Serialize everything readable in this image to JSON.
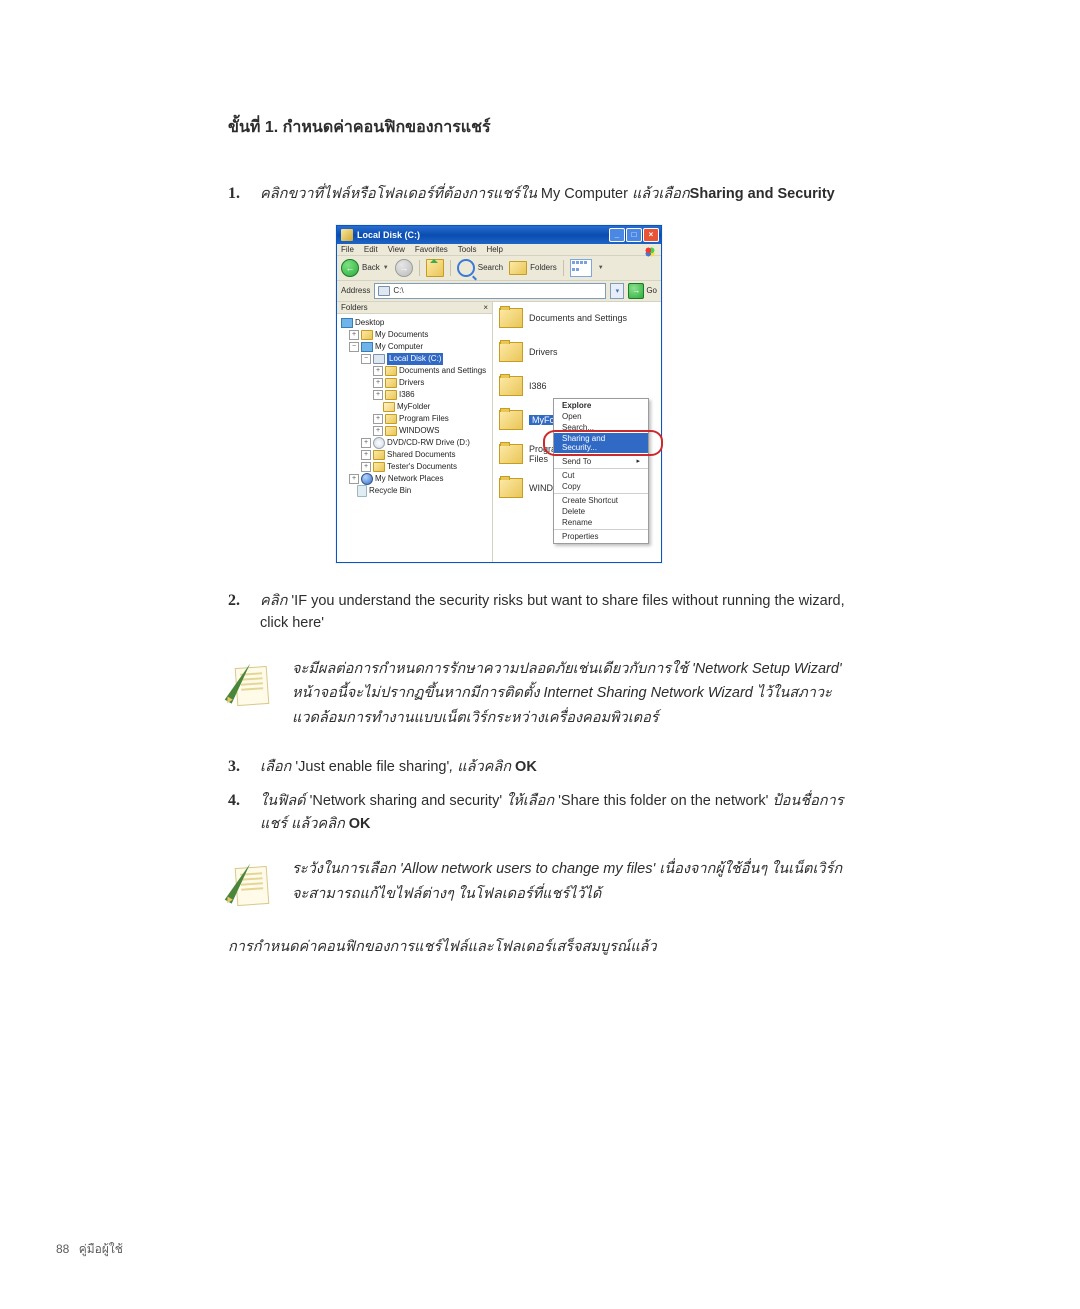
{
  "section_title": "ขั้นที่ 1. กำหนดค่าคอนฟิกของการแชร์",
  "steps": {
    "s1": {
      "num": "1.",
      "pre": "คลิกขวาที่ไฟล์หรือโฟลเดอร์ที่ต้องการแชร์ใน ",
      "em": "My Computer",
      "mid": " แล้วเลือก",
      "bold": "Sharing and Security"
    },
    "s2": {
      "num": "2.",
      "pre": "คลิก ",
      "quote": "'IF you understand the security risks but want to share files without running the wizard, click here'"
    },
    "s3": {
      "num": "3.",
      "pre": "เลือก ",
      "quote": "'Just enable file sharing'",
      "mid": ", แล้วคลิก ",
      "bold": "OK"
    },
    "s4": {
      "num": "4.",
      "pre": "ในฟิลด์ ",
      "q1": "'Network sharing and security'",
      "mid": " ให้เลือก ",
      "q2": "'Share this folder on the network'",
      "post": " ป้อนชื่อการแชร์ แล้วคลิก ",
      "bold": "OK"
    }
  },
  "info1": {
    "l1": "จะมีผลต่อการกำหนดการรักษาความปลอดภัยเช่นเดียวกับการใช้ 'Network Setup Wizard'",
    "l2": "หน้าจอนี้จะไม่ปรากฏขึ้นหากมีการติดตั้ง Internet Sharing Network Wizard ไว้ในสภาวะแวดล้อมการทำงานแบบเน็ตเวิร์กระหว่างเครื่องคอมพิวเตอร์"
  },
  "info2": {
    "text": "ระวังในการเลือก 'Allow network users to change my files' เนื่องจากผู้ใช้อื่นๆ ในเน็ตเวิร์กจะสามารถแก้ไขไฟล์ต่างๆ ในโฟลเดอร์ที่แชร์ไว้ได้"
  },
  "closing": "การกำหนดค่าคอนฟิกของการแชร์ไฟล์และโฟลเดอร์เสร็จสมบูรณ์แล้ว",
  "footer": {
    "page": "88",
    "label": "คู่มือผู้ใช้"
  },
  "win": {
    "title": "Local Disk (C:)",
    "menus": [
      "File",
      "Edit",
      "View",
      "Favorites",
      "Tools",
      "Help"
    ],
    "toolbar": {
      "back": "Back",
      "search": "Search",
      "folders": "Folders"
    },
    "address": {
      "label": "Address",
      "value": "C:\\",
      "go": "Go"
    },
    "tree": {
      "header": "Folders",
      "items": {
        "desktop": "Desktop",
        "mydocs": "My Documents",
        "mycomp": "My Computer",
        "local": "Local Disk (C:)",
        "docset": "Documents and Settings",
        "drivers": "Drivers",
        "i386": "I386",
        "myfolder": "MyFolder",
        "progfiles": "Program Files",
        "windows": "WINDOWS",
        "dvd": "DVD/CD-RW Drive (D:)",
        "shared": "Shared Documents",
        "tester": "Tester's Documents",
        "netplaces": "My Network Places",
        "recycle": "Recycle Bin"
      }
    },
    "list": {
      "docset": "Documents and Settings",
      "drivers": "Drivers",
      "i386": "I386",
      "myfolder": "MyFolder",
      "progfiles": "Program Files",
      "windows": "WINDOWS"
    },
    "ctx": {
      "explore": "Explore",
      "open": "Open",
      "search": "Search...",
      "sharing": "Sharing and Security...",
      "sendto": "Send To",
      "cut": "Cut",
      "copy": "Copy",
      "shortcut": "Create Shortcut",
      "del": "Delete",
      "rename": "Rename",
      "props": "Properties"
    }
  }
}
